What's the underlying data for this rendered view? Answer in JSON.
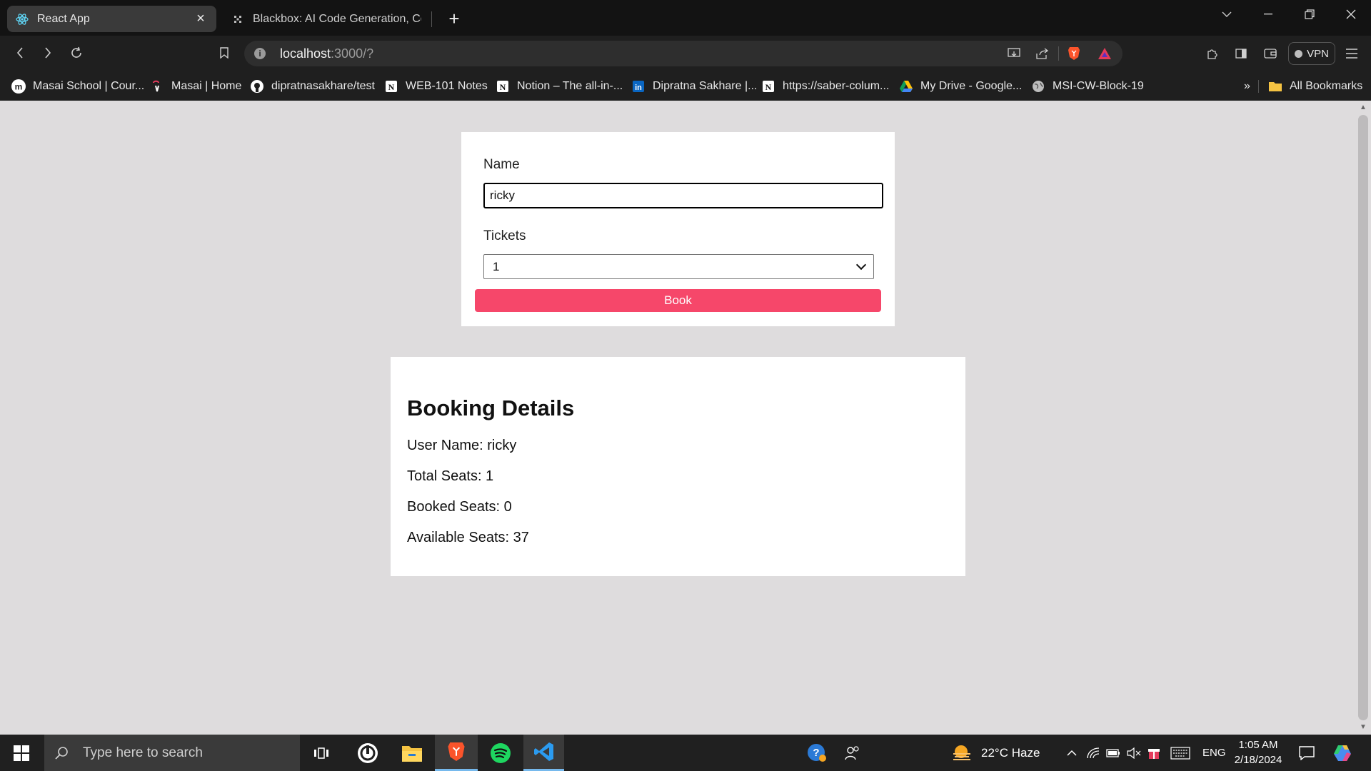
{
  "browser": {
    "tabs": [
      {
        "title": "React App",
        "active": true,
        "icon": "react-icon"
      },
      {
        "title": "Blackbox: AI Code Generation, Code",
        "active": false,
        "icon": "blackbox-icon"
      }
    ],
    "url_host": "localhost",
    "url_path": ":3000/?",
    "vpn_label": "VPN",
    "bookmarks": [
      {
        "label": "Masai School | Cour...",
        "icon": "masai-icon"
      },
      {
        "label": "Masai | Home",
        "icon": "masai-home-icon"
      },
      {
        "label": "dipratnasakhare/test",
        "icon": "github-icon"
      },
      {
        "label": "WEB-101 Notes",
        "icon": "notion-icon"
      },
      {
        "label": "Notion – The all-in-...",
        "icon": "notion-icon"
      },
      {
        "label": "Dipratna Sakhare |...",
        "icon": "linkedin-icon"
      },
      {
        "label": "https://saber-colum...",
        "icon": "notion-icon"
      },
      {
        "label": "My Drive - Google...",
        "icon": "google-drive-icon"
      },
      {
        "label": "MSI-CW-Block-19",
        "icon": "globe-icon"
      }
    ],
    "all_bookmarks_label": "All Bookmarks",
    "overflow_label": "»"
  },
  "form": {
    "name_label": "Name",
    "name_value": "ricky",
    "tickets_label": "Tickets",
    "tickets_value": "1",
    "book_label": "Book",
    "book_color": "#f6476a"
  },
  "details": {
    "title": "Booking Details",
    "user_name": "User Name: ricky",
    "total_seats": "Total Seats: 1",
    "booked_seats": "Booked Seats: 0",
    "available_seats": "Available Seats: 37"
  },
  "taskbar": {
    "search_placeholder": "Type here to search",
    "weather": "22°C  Haze",
    "language": "ENG",
    "time": "1:05 AM",
    "date": "2/18/2024"
  }
}
